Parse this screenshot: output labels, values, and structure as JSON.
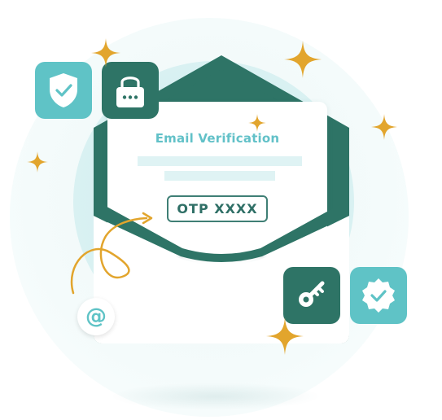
{
  "letter": {
    "title": "Email Verification",
    "otp": "OTP XXXX"
  },
  "icons": {
    "shield": "shield-check-icon",
    "lock": "padlock-icon",
    "key": "key-icon",
    "badge": "verified-badge-icon",
    "at": "at-sign-icon"
  },
  "at_symbol": "@",
  "colors": {
    "teal": "#5fc3c6",
    "dark_green": "#2e7466",
    "gold": "#e2a52d",
    "light_teal": "#cdeced"
  }
}
